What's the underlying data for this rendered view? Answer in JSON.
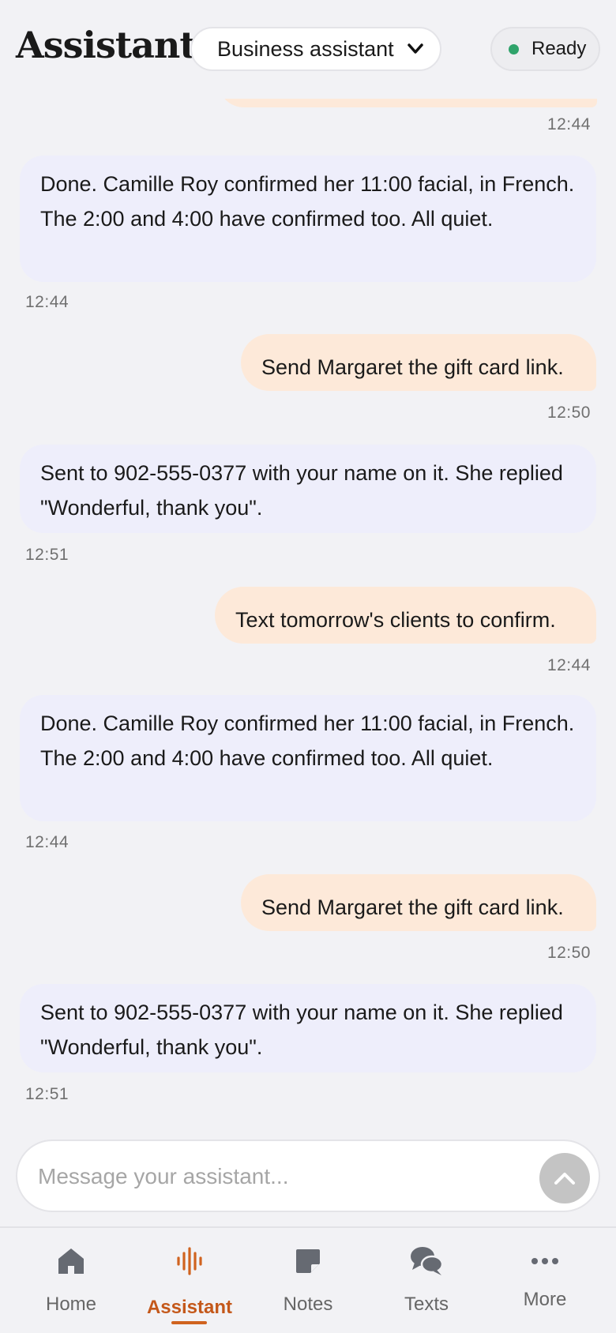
{
  "header": {
    "title": "Assistant",
    "mode_select": "Business assistant",
    "status": "Ready",
    "status_color": "#2fa36b"
  },
  "messages": [
    {
      "role": "assistant",
      "text": "Done. Camille Roy confirmed her 11:00 facial, in French. The 2:00 and 4:00 have confirmed too. All quiet.",
      "time": "12:44"
    },
    {
      "role": "user",
      "text": "Send Margaret the gift card link.",
      "time": "12:50"
    },
    {
      "role": "assistant",
      "text": "Sent to 902-555-0377 with your name on it. She replied \"Wonderful, thank you\".",
      "time": "12:51"
    },
    {
      "role": "user",
      "text": "Text tomorrow's clients to confirm.",
      "time": "12:44"
    },
    {
      "role": "assistant",
      "text": "Done. Camille Roy confirmed her 11:00 facial, in French. The 2:00 and 4:00 have confirmed too. All quiet.",
      "time": "12:44"
    },
    {
      "role": "user",
      "text": "Send Margaret the gift card link.",
      "time": "12:50"
    },
    {
      "role": "assistant",
      "text": "Sent to 902-555-0377 with your name on it. She replied \"Wonderful, thank you\".",
      "time": "12:51"
    }
  ],
  "partial_top_time": "12:44",
  "composer": {
    "placeholder": "Message your assistant...",
    "send_icon": "chevron-up-icon"
  },
  "tabs": [
    {
      "label": "Home",
      "icon": "home-icon"
    },
    {
      "label": "Assistant",
      "icon": "audio-wave-icon",
      "active": true
    },
    {
      "label": "Notes",
      "icon": "note-icon"
    },
    {
      "label": "Texts",
      "icon": "chat-bubbles-icon"
    },
    {
      "label": "More",
      "icon": "more-dots-icon"
    }
  ],
  "colors": {
    "accent": "#c4581a",
    "user_bubble": "#fde9d9",
    "assistant_bubble": "#eeeefb",
    "background": "#f2f2f5"
  }
}
